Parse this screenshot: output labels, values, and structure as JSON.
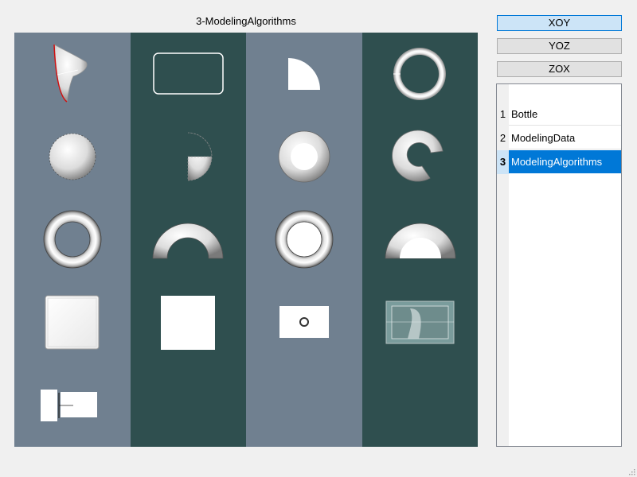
{
  "viewer": {
    "title": "3-ModelingAlgorithms",
    "column_colors": [
      "#708090",
      "#2f4f4f",
      "#708090",
      "#2f4f4f"
    ]
  },
  "view_buttons": [
    {
      "label": "XOY",
      "active": true
    },
    {
      "label": "YOZ",
      "active": false
    },
    {
      "label": "ZOX",
      "active": false
    }
  ],
  "list": {
    "items": [
      {
        "index": "1",
        "label": "Bottle",
        "selected": false
      },
      {
        "index": "2",
        "label": "ModelingData",
        "selected": false
      },
      {
        "index": "3",
        "label": "ModelingAlgorithms",
        "selected": true
      }
    ]
  },
  "colors": {
    "accent": "#0078d7",
    "selection_light": "#cce4f7"
  }
}
